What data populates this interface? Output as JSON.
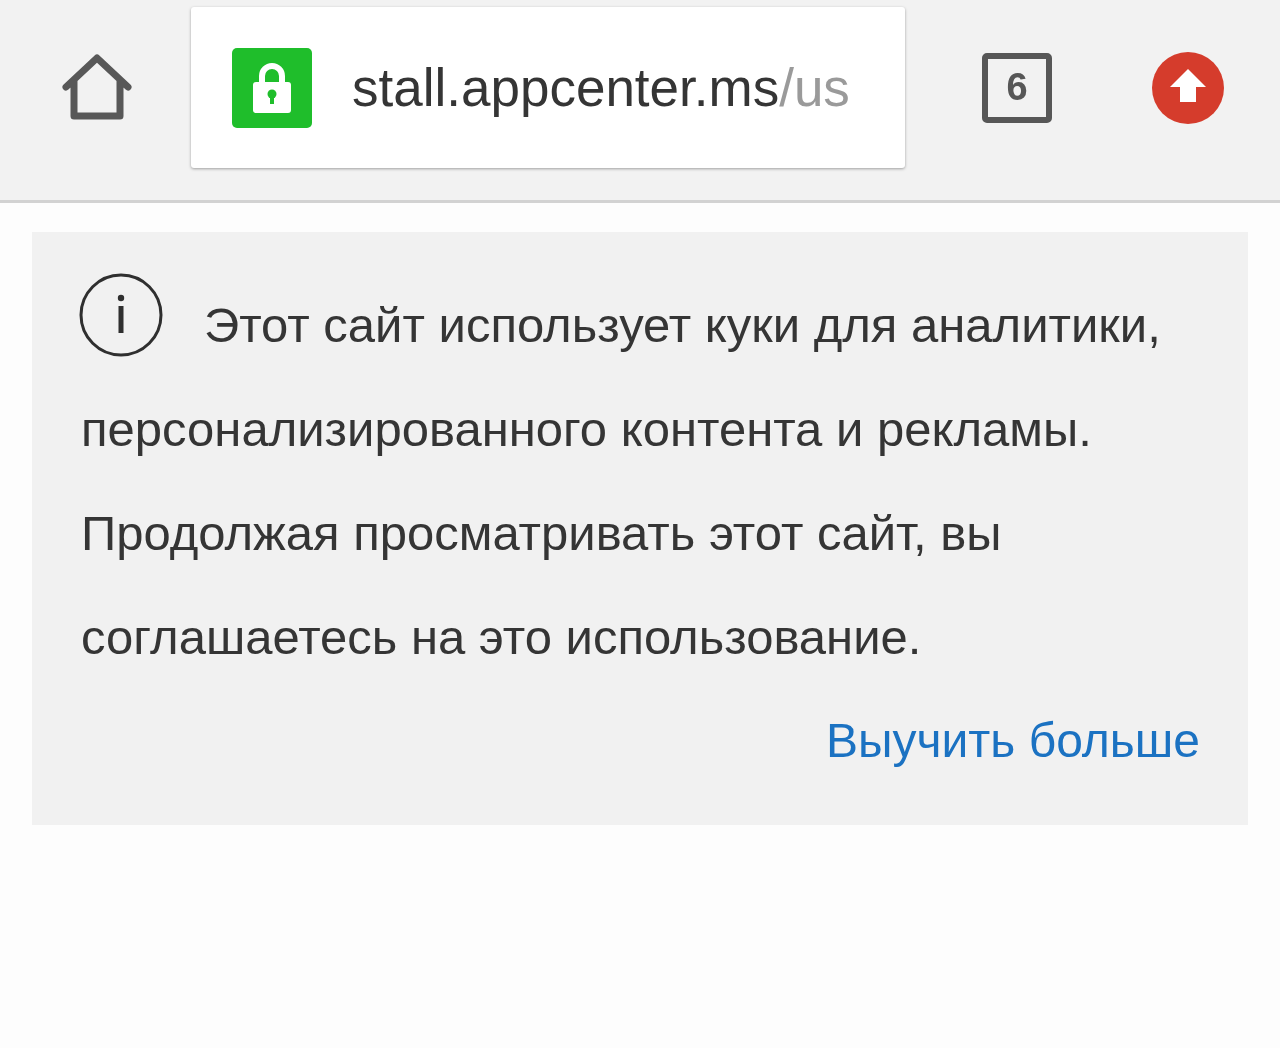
{
  "toolbar": {
    "address_bar": {
      "secure": true,
      "host": "stall.appcenter.ms",
      "path": "/us"
    },
    "tab_count": "6"
  },
  "cookie_banner": {
    "message_lines": [
      "Этот сайт использует куки для аналитики,",
      "персонализированного контента и рекламы.",
      "Продолжая просматривать этот сайт, вы",
      "соглашаетесь на это использование."
    ],
    "link": "Выучить больше"
  }
}
